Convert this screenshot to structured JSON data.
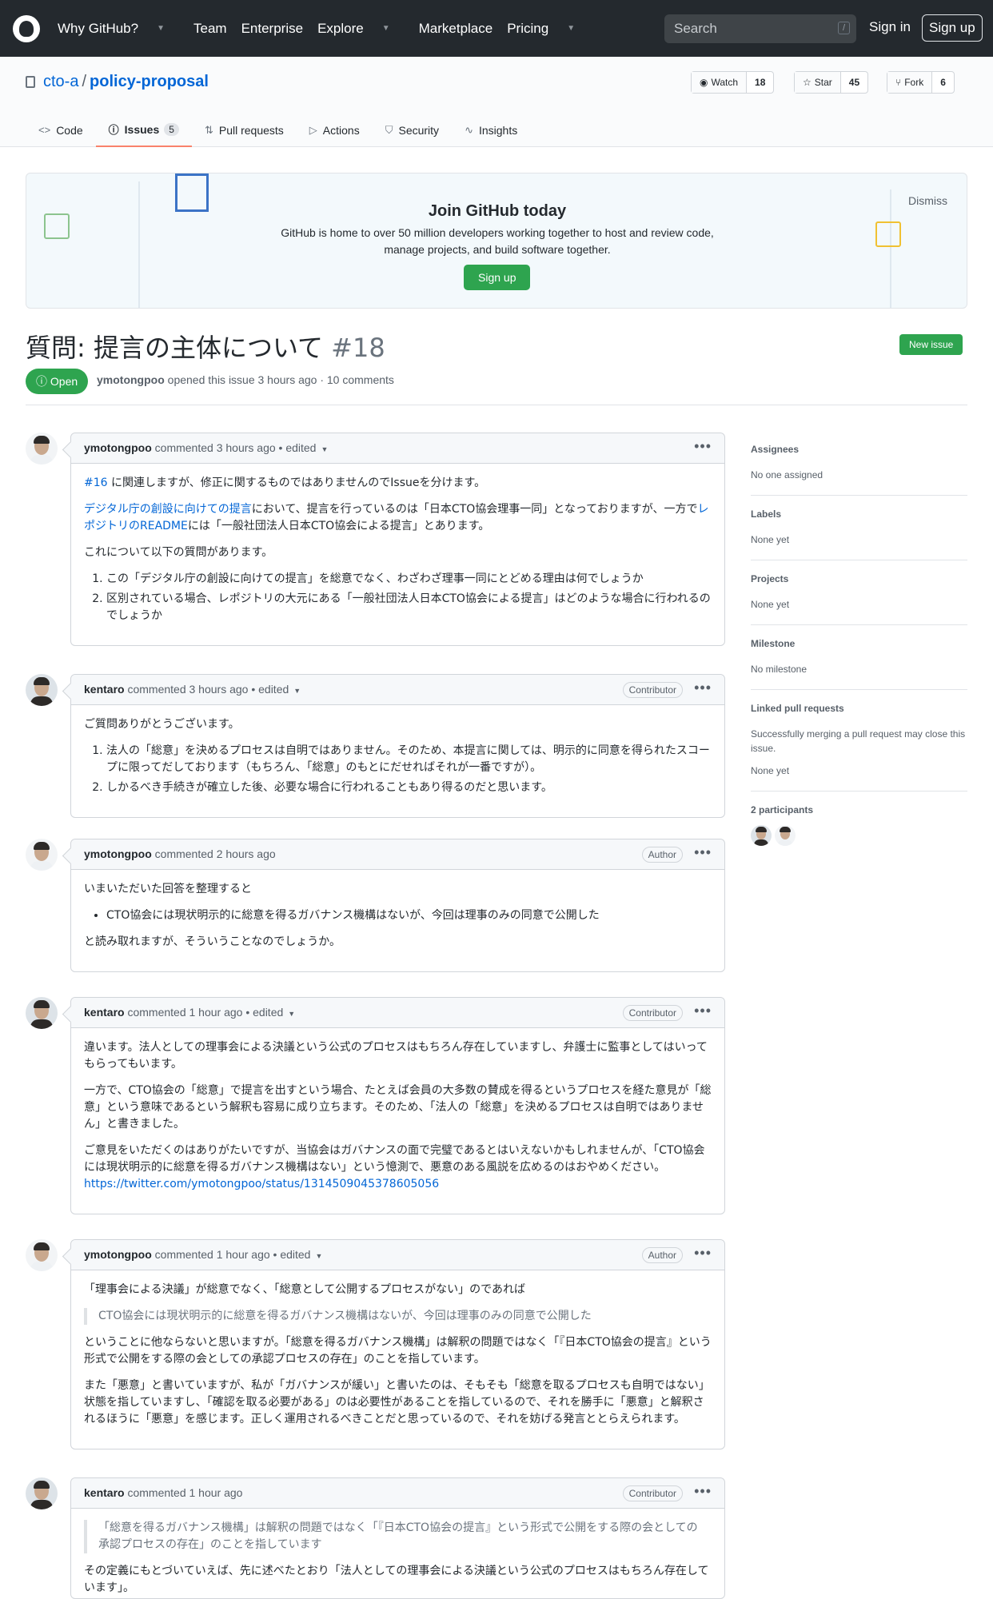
{
  "header": {
    "nav": [
      "Why GitHub?",
      "Team",
      "Enterprise",
      "Explore",
      "Marketplace",
      "Pricing"
    ],
    "search_placeholder": "Search",
    "search_key": "/",
    "sign_in": "Sign in",
    "sign_up": "Sign up"
  },
  "repo": {
    "owner": "cto-a",
    "name": "policy-proposal",
    "watch_label": "Watch",
    "watch_count": "18",
    "star_label": "Star",
    "star_count": "45",
    "fork_label": "Fork",
    "fork_count": "6"
  },
  "tabs": [
    {
      "label": "Code"
    },
    {
      "label": "Issues",
      "count": "5"
    },
    {
      "label": "Pull requests"
    },
    {
      "label": "Actions"
    },
    {
      "label": "Security"
    },
    {
      "label": "Insights"
    }
  ],
  "banner": {
    "title": "Join GitHub today",
    "text1": "GitHub is home to over 50 million developers working together to host and review code,",
    "text2": "manage projects, and build software together.",
    "signup": "Sign up",
    "dismiss": "Dismiss"
  },
  "issue": {
    "title": "質問: 提言の主体について",
    "number": "#18",
    "new_issue": "New issue",
    "state": "Open",
    "author": "ymotongpoo",
    "meta": "opened this issue 3 hours ago · 10 comments"
  },
  "comments": [
    {
      "author": "ymotongpoo",
      "meta": "commented 3 hours ago • edited",
      "role": ""
    },
    {
      "author": "kentaro",
      "meta": "commented 3 hours ago • edited",
      "role": "Contributor"
    },
    {
      "author": "ymotongpoo",
      "meta": "commented 2 hours ago",
      "role": "Author"
    },
    {
      "author": "kentaro",
      "meta": "commented 1 hour ago • edited",
      "role": "Contributor"
    },
    {
      "author": "ymotongpoo",
      "meta": "commented 1 hour ago • edited",
      "role": "Author"
    },
    {
      "author": "kentaro",
      "meta": "commented 1 hour ago",
      "role": "Contributor"
    }
  ],
  "c1": {
    "link1": "#16",
    "p1": "に関連しますが、修正に関するものではありませんのでIssueを分けます。",
    "link2": "デジタル庁の創設に向けての提言",
    "p2a": "において、提言を行っているのは「日本CTO協会理事一同」となっておりますが、一方で",
    "link3": "レポジトリのREADME",
    "p2b": "には「一般社団法人日本CTO協会による提言」とあります。",
    "p3": "これについて以下の質問があります。",
    "li1": "この「デジタル庁の創設に向けての提言」を総意でなく、わざわざ理事一同にとどめる理由は何でしょうか",
    "li2": "区別されている場合、レポジトリの大元にある「一般社団法人日本CTO協会による提言」はどのような場合に行われるのでしょうか"
  },
  "c2": {
    "p1": "ご質問ありがとうございます。",
    "li1": "法人の「総意」を決めるプロセスは自明ではありません。そのため、本提言に関しては、明示的に同意を得られたスコープに限ってだしております（もちろん、「総意」のもとにだせればそれが一番ですが）。",
    "li2": "しかるべき手続きが確立した後、必要な場合に行われることもあり得るのだと思います。"
  },
  "c3": {
    "p1": "いまいただいた回答を整理すると",
    "li1": "CTO協会には現状明示的に総意を得るガバナンス機構はないが、今回は理事のみの同意で公開した",
    "p2": "と読み取れますが、そういうことなのでしょうか。"
  },
  "c4": {
    "p1": "違います。法人としての理事会による決議という公式のプロセスはもちろん存在していますし、弁護士に監事としてはいってもらってもいます。",
    "p2": "一方で、CTO協会の「総意」で提言を出すという場合、たとえば会員の大多数の賛成を得るというプロセスを経た意見が「総意」という意味であるという解釈も容易に成り立ちます。そのため、「法人の「総意」を決めるプロセスは自明ではありません」と書きました。",
    "p3": "ご意見をいただくのはありがたいですが、当協会はガバナンスの面で完璧であるとはいえないかもしれませんが、「CTO協会には現状明示的に総意を得るガバナンス機構はない」という憶測で、悪意のある風説を広めるのはおやめください。",
    "link": "https://twitter.com/ymotongpoo/status/1314509045378605056"
  },
  "c5": {
    "p1": "「理事会による決議」が総意でなく、「総意として公開するプロセスがない」のであれば",
    "quote": "CTO協会には現状明示的に総意を得るガバナンス機構はないが、今回は理事のみの同意で公開した",
    "p2": "ということに他ならないと思いますが。「総意を得るガバナンス機構」は解釈の問題ではなく「『日本CTO協会の提言』という形式で公開をする際の会としての承認プロセスの存在」のことを指しています。",
    "p3": "また「悪意」と書いていますが、私が「ガバナンスが緩い」と書いたのは、そもそも「総意を取るプロセスも自明ではない」状態を指していますし、「確認を取る必要がある」のは必要性があることを指しているので、それを勝手に「悪意」と解釈されるほうに「悪意」を感じます。正しく運用されるべきことだと思っているので、それを妨げる発言ととらえられます。"
  },
  "c6": {
    "quote": "「総意を得るガバナンス機構」は解釈の問題ではなく「『日本CTO協会の提言』という形式で公開をする際の会としての承認プロセスの存在」のことを指しています",
    "p1": "その定義にもとづいていえば、先に述べたとおり「法人としての理事会による決議という公式のプロセスはもちろん存在しています」。"
  },
  "sidebar": {
    "assignees_h": "Assignees",
    "assignees_v": "No one assigned",
    "labels_h": "Labels",
    "labels_v": "None yet",
    "projects_h": "Projects",
    "projects_v": "None yet",
    "milestone_h": "Milestone",
    "milestone_v": "No milestone",
    "linked_h": "Linked pull requests",
    "linked_desc": "Successfully merging a pull request may close this issue.",
    "linked_v": "None yet",
    "participants_h": "2 participants"
  }
}
